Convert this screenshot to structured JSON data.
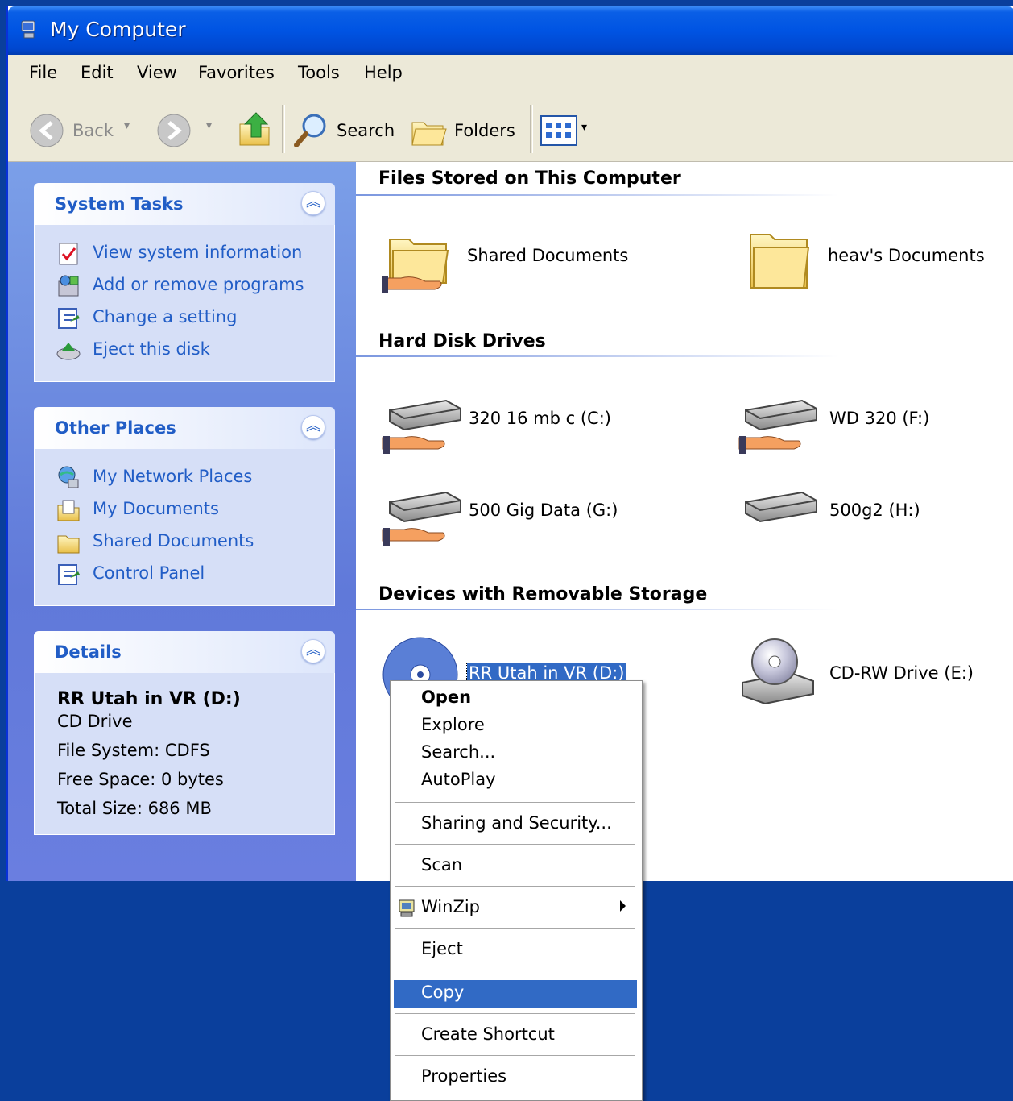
{
  "window": {
    "title": "My Computer"
  },
  "menu": [
    "File",
    "Edit",
    "View",
    "Favorites",
    "Tools",
    "Help"
  ],
  "toolbar": {
    "back": "Back",
    "search": "Search",
    "folders": "Folders"
  },
  "panels": {
    "system_tasks": {
      "title": "System Tasks",
      "items": [
        {
          "label": "View system information",
          "icon": "sysinfo-icon"
        },
        {
          "label": "Add or remove programs",
          "icon": "add-remove-icon"
        },
        {
          "label": "Change a setting",
          "icon": "control-panel-icon"
        },
        {
          "label": "Eject this disk",
          "icon": "eject-icon"
        }
      ]
    },
    "other_places": {
      "title": "Other Places",
      "items": [
        {
          "label": "My Network Places",
          "icon": "network-icon"
        },
        {
          "label": "My Documents",
          "icon": "documents-icon"
        },
        {
          "label": "Shared Documents",
          "icon": "folder-icon"
        },
        {
          "label": "Control Panel",
          "icon": "control-panel-icon"
        }
      ]
    },
    "details": {
      "title": "Details",
      "name": "RR Utah in VR (D:)",
      "type": "CD Drive",
      "fs": "File System: CDFS",
      "free": "Free Space: 0 bytes",
      "total": "Total Size: 686 MB"
    }
  },
  "groups": {
    "files": {
      "title": "Files Stored on This Computer",
      "items": [
        "Shared Documents",
        "heav's Documents"
      ]
    },
    "hdd": {
      "title": "Hard Disk Drives",
      "items": [
        "320 16 mb c (C:)",
        "WD 320 (F:)",
        "500 Gig Data (G:)",
        "500g2 (H:)"
      ]
    },
    "removable": {
      "title": "Devices with Removable Storage",
      "items": [
        "RR Utah in VR (D:)",
        "CD-RW Drive (E:)"
      ]
    }
  },
  "context_menu": {
    "items": [
      "Open",
      "Explore",
      "Search...",
      "AutoPlay",
      "Sharing and Security...",
      "Scan",
      "WinZip",
      "Eject",
      "Copy",
      "Create Shortcut",
      "Properties"
    ],
    "highlighted": "Copy"
  }
}
